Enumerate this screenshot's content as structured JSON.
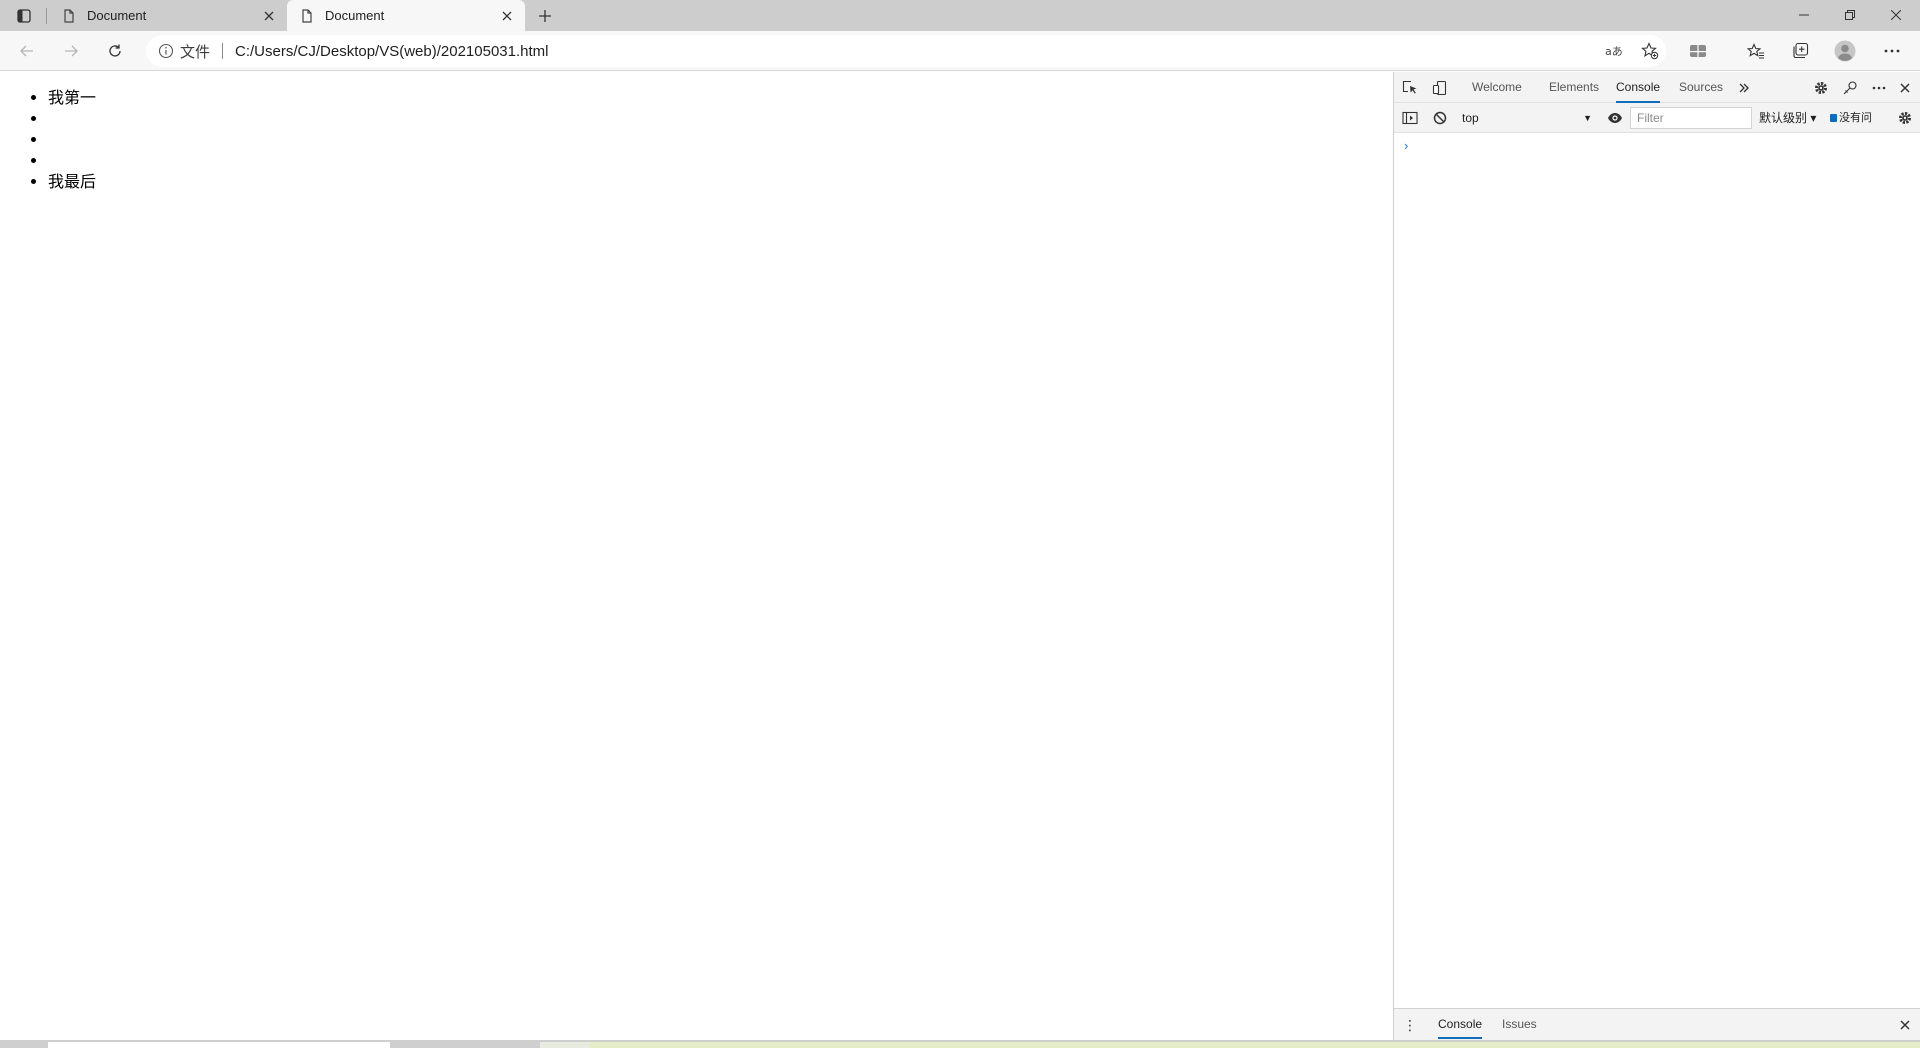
{
  "tabs": [
    {
      "title": "Document",
      "active": false
    },
    {
      "title": "Document",
      "active": true
    }
  ],
  "address_bar": {
    "scheme_label": "文件",
    "url": "C:/Users/CJ/Desktop/VS(web)/202105031.html"
  },
  "page": {
    "list_items": [
      "我第一",
      "",
      "",
      "",
      "我最后"
    ]
  },
  "devtools": {
    "tabs": [
      "Welcome",
      "Elements",
      "Console",
      "Sources"
    ],
    "active_tab": "Console",
    "context": "top",
    "filter_placeholder": "Filter",
    "level_label": "默认级别 ▾",
    "issues_label": "没有问",
    "prompt_symbol": "›",
    "drawer_tabs": [
      "Console",
      "Issues"
    ],
    "drawer_more": "⋮"
  },
  "colors": {
    "accent": "#0f6cbd",
    "tab_strip": "#cdcdcd",
    "toolbar": "#f7f7f7"
  }
}
